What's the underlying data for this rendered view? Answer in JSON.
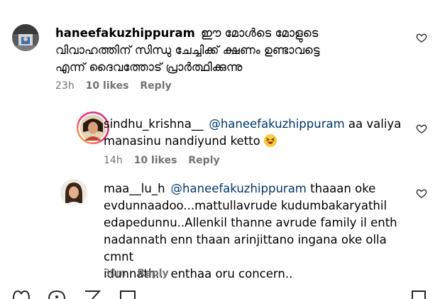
{
  "comments": [
    {
      "username": "haneefakuzhippuram",
      "mention": "",
      "text_lines": [
        "ഈ മോൾടെ മോളുടെ",
        "വിവാഹത്തിന് സിന്ധു ചേച്ചിക്ക് ക്ഷണം ഉണ്ടാവട്ടെ",
        "എന്ന് ദൈവത്തോട് പ്രാർത്ഥിക്കുന്നു"
      ],
      "time": "23h",
      "likes": "10 likes",
      "reply": "Reply"
    },
    {
      "username": "sindhu_krishna__",
      "mention": "@haneefakuzhippuram",
      "text_line1_rest": " aa valiya",
      "text_line2": "manasinu nandiyund ketto",
      "emoji": "grinning-squinting-face",
      "time": "14h",
      "likes": "10 likes",
      "reply": "Reply"
    },
    {
      "username": "maa__lu_h",
      "mention": "@haneefakuzhippuram",
      "text_line1_rest": " thaaan oke",
      "text_lines_rest": [
        "evdunnaadoo...mattullavrude kudumbakaryathil",
        "edapedunnu..Allenkil thanne avrude family il enth",
        "nadannath enn thaan arinjittano ingana oke olla cmnt",
        "idunnath... enthaa oru concern.."
      ],
      "time": "30m",
      "reply": "Reply"
    }
  ],
  "colors": {
    "mention": "#00376b",
    "meta": "#737373",
    "story_ring_start": "#f9ce34",
    "story_ring_end": "#ee2a7b"
  },
  "icons": {
    "like": "heart-outline-icon",
    "bottom_bar": [
      "heart-icon",
      "comment-icon",
      "share-icon",
      "save-icon",
      "bookmark-icon"
    ]
  }
}
